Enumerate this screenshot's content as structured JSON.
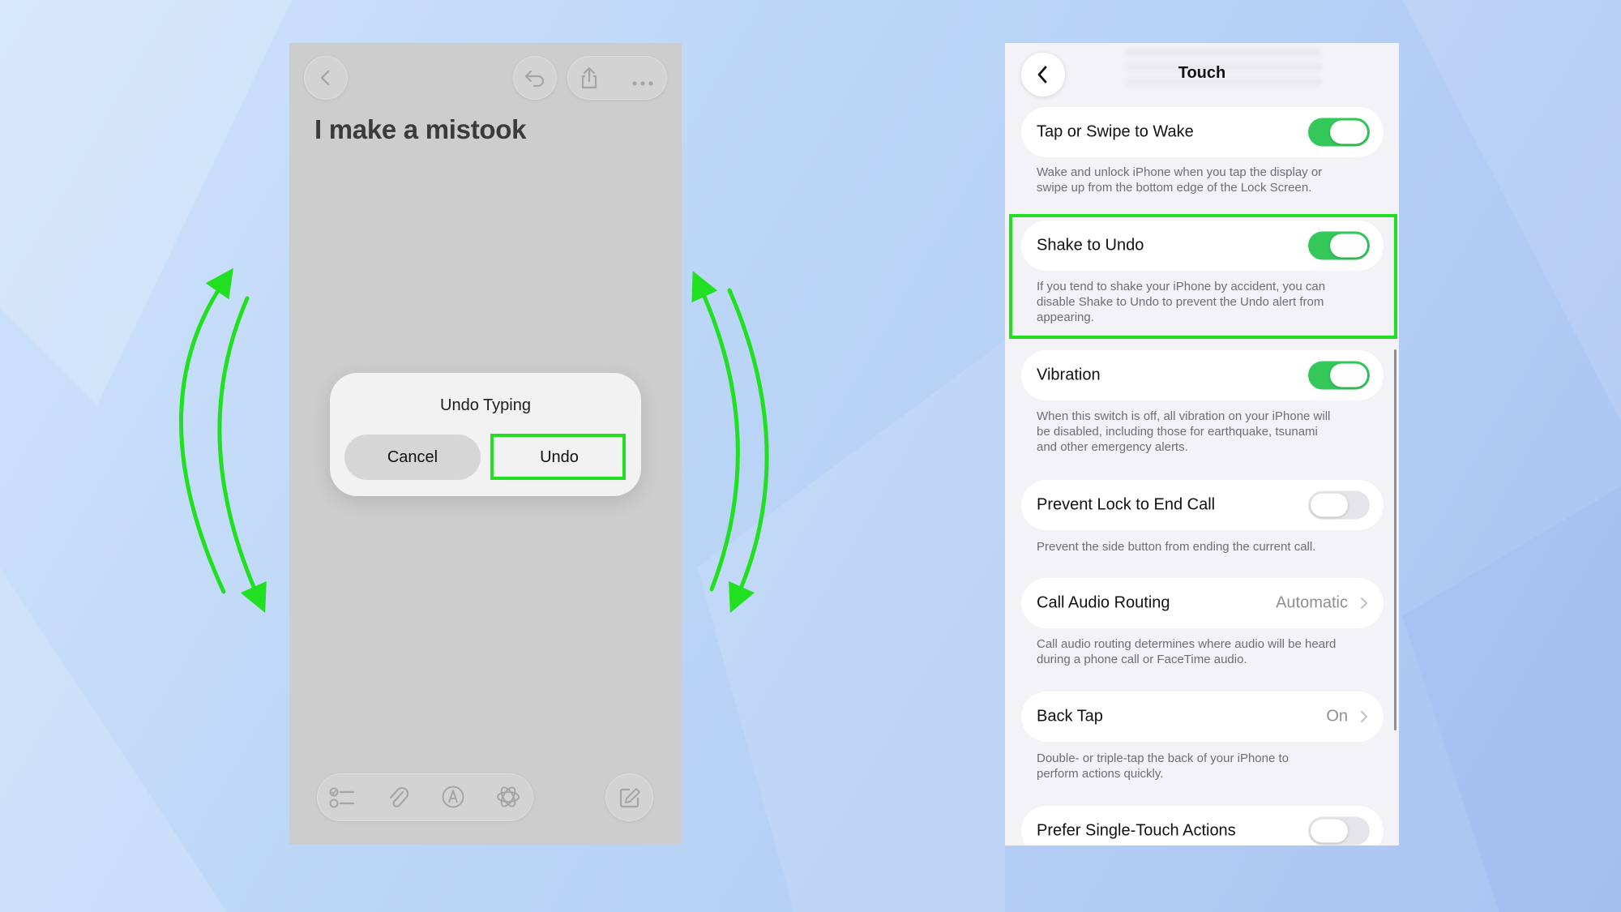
{
  "colors": {
    "highlight": "#21e021",
    "toggle_on": "#34c759",
    "toggle_off": "#e4e4e9",
    "arrow": "#21e021"
  },
  "notes_screen": {
    "toolbar_top": {
      "back_icon": "chevron-left-icon",
      "undo_icon": "undo-arrow-icon",
      "share_icon": "share-icon",
      "more_icon": "ellipsis-icon"
    },
    "note_title": "I make a mistook",
    "toolbar_bottom": {
      "checklist_icon": "checklist-icon",
      "attachment_icon": "paperclip-icon",
      "markup_icon": "markup-pen-icon",
      "ai_icon": "apple-intelligence-icon",
      "compose_icon": "compose-icon"
    },
    "alert": {
      "title": "Undo Typing",
      "cancel_label": "Cancel",
      "undo_label": "Undo"
    }
  },
  "settings_screen": {
    "nav": {
      "back_icon": "chevron-left-icon",
      "title": "Touch"
    },
    "rows": [
      {
        "label": "Tap or Swipe to Wake",
        "toggle": "on",
        "footer": [
          "Wake and unlock iPhone when you tap the display or",
          "swipe up from the bottom edge of the Lock Screen."
        ]
      },
      {
        "label": "Shake to Undo",
        "toggle": "on",
        "footer": [
          "If you tend to shake your iPhone by accident, you can",
          "disable Shake to Undo to prevent the Undo alert from",
          "appearing."
        ]
      },
      {
        "label": "Vibration",
        "toggle": "on",
        "footer": [
          "When this switch is off, all vibration on your iPhone will",
          "be disabled, including those for earthquake, tsunami",
          "and other emergency alerts."
        ]
      },
      {
        "label": "Prevent Lock to End Call",
        "toggle": "off",
        "footer": [
          "Prevent the side button from ending the current call."
        ]
      },
      {
        "label": "Call Audio Routing",
        "value": "Automatic",
        "footer": [
          "Call audio routing determines where audio will be heard",
          "during a phone call or FaceTime audio."
        ]
      },
      {
        "label": "Back Tap",
        "value": "On",
        "footer": [
          "Double- or triple-tap the back of your iPhone to",
          "perform actions quickly."
        ]
      },
      {
        "label": "Prefer Single-Touch Actions",
        "toggle": "off"
      }
    ]
  }
}
